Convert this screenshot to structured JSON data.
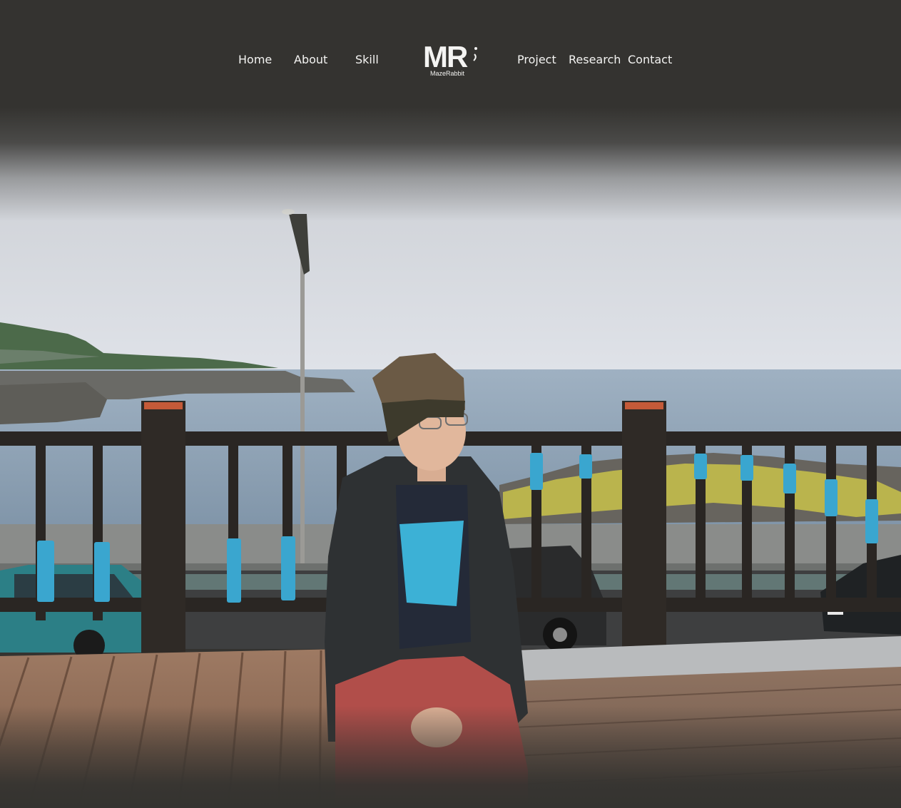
{
  "nav": {
    "items": [
      {
        "label": "Home"
      },
      {
        "label": "About"
      },
      {
        "label": "Skill"
      },
      {
        "label": "Project"
      },
      {
        "label": "Research"
      },
      {
        "label": "Contact"
      }
    ],
    "logo": {
      "mark": "MR",
      "subtitle": "MazeRabbit"
    }
  },
  "hero": {
    "image": "portrait-photo-seaside-bench"
  },
  "colors": {
    "background": "#343330",
    "nav_text": "#f4f4f2",
    "railing_accent": "#3aa6cf"
  }
}
